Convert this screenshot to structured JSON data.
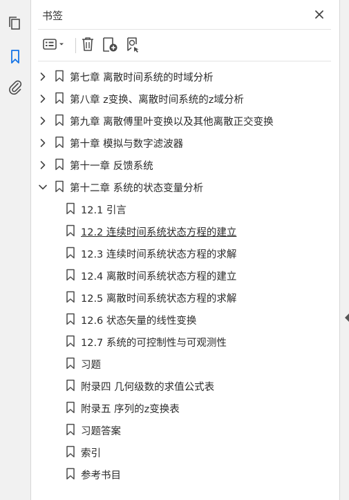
{
  "panel": {
    "title": "书签",
    "close_icon": "close-icon"
  },
  "toolbar": {
    "options_icon": "options-menu-icon",
    "delete_icon": "trash-icon",
    "new_bookmark_icon": "new-bookmark-icon",
    "find_bookmark_icon": "find-current-bookmark-icon"
  },
  "rail": {
    "items": [
      {
        "name": "page-thumbnails-icon",
        "active": false
      },
      {
        "name": "bookmarks-icon",
        "active": true
      },
      {
        "name": "attachments-icon",
        "active": false
      }
    ]
  },
  "bookmarks": [
    {
      "label": "第七章  离散时间系统的时域分析",
      "level": 0,
      "expandable": true,
      "expanded": false,
      "underline": false
    },
    {
      "label": "第八章  z变换、离散时间系统的z域分析",
      "level": 0,
      "expandable": true,
      "expanded": false,
      "underline": false
    },
    {
      "label": "第九章  离散傅里叶变换以及其他离散正交变换",
      "level": 0,
      "expandable": true,
      "expanded": false,
      "underline": false
    },
    {
      "label": "第十章  模拟与数字滤波器",
      "level": 0,
      "expandable": true,
      "expanded": false,
      "underline": false
    },
    {
      "label": "第十一章  反馈系统",
      "level": 0,
      "expandable": true,
      "expanded": false,
      "underline": false
    },
    {
      "label": "第十二章  系统的状态变量分析",
      "level": 0,
      "expandable": true,
      "expanded": true,
      "underline": false
    },
    {
      "label": "12.1  引言",
      "level": 1,
      "expandable": false,
      "expanded": false,
      "underline": false
    },
    {
      "label": "12.2  连续时间系统状态方程的建立",
      "level": 1,
      "expandable": false,
      "expanded": false,
      "underline": true
    },
    {
      "label": "12.3  连续时间系统状态方程的求解",
      "level": 1,
      "expandable": false,
      "expanded": false,
      "underline": false
    },
    {
      "label": "12.4  离散时间系统状态方程的建立",
      "level": 1,
      "expandable": false,
      "expanded": false,
      "underline": false
    },
    {
      "label": "12.5  离散时间系统状态方程的求解",
      "level": 1,
      "expandable": false,
      "expanded": false,
      "underline": false
    },
    {
      "label": "12.6  状态矢量的线性变换",
      "level": 1,
      "expandable": false,
      "expanded": false,
      "underline": false
    },
    {
      "label": "12.7  系统的可控制性与可观测性",
      "level": 1,
      "expandable": false,
      "expanded": false,
      "underline": false
    },
    {
      "label": "习题",
      "level": 1,
      "expandable": false,
      "expanded": false,
      "underline": false
    },
    {
      "label": "附录四  几何级数的求值公式表",
      "level": 1,
      "expandable": false,
      "expanded": false,
      "underline": false
    },
    {
      "label": "附录五  序列的z变换表",
      "level": 1,
      "expandable": false,
      "expanded": false,
      "underline": false
    },
    {
      "label": "习题答案",
      "level": 1,
      "expandable": false,
      "expanded": false,
      "underline": false
    },
    {
      "label": "索引",
      "level": 1,
      "expandable": false,
      "expanded": false,
      "underline": false
    },
    {
      "label": "参考书目",
      "level": 1,
      "expandable": false,
      "expanded": false,
      "underline": false
    }
  ],
  "colors": {
    "accent": "#1473e6",
    "icon": "#4b4b4b",
    "text": "#2b2b2b"
  }
}
